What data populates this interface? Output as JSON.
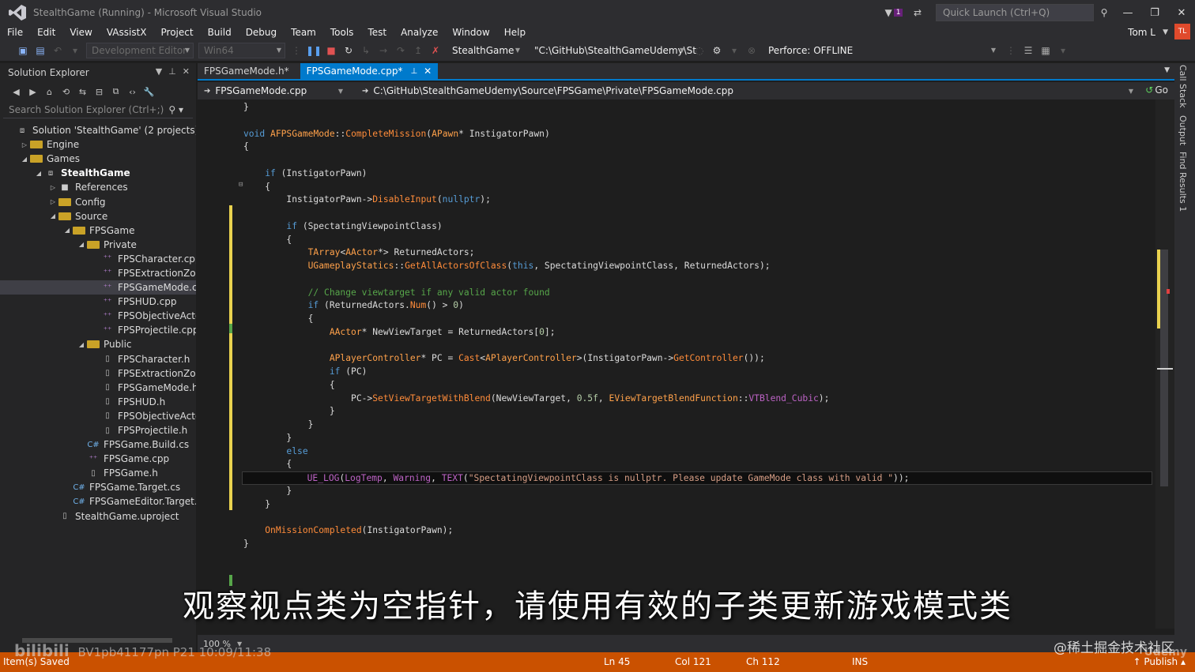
{
  "window": {
    "title": "StealthGame (Running) - Microsoft Visual Studio",
    "notification_count": "1",
    "quick_launch_placeholder": "Quick Launch (Ctrl+Q)"
  },
  "menu": [
    "File",
    "Edit",
    "View",
    "VAssistX",
    "Project",
    "Build",
    "Debug",
    "Team",
    "Tools",
    "Test",
    "Analyze",
    "Window",
    "Help"
  ],
  "user": {
    "name": "Tom L",
    "initials": "TL"
  },
  "toolbar": {
    "configuration": "Development Editor",
    "platform": "Win64",
    "startup_project": "StealthGame",
    "path": "\"C:\\GitHub\\StealthGameUdemy\\St",
    "source_control": "Perforce: OFFLINE"
  },
  "solution_explorer": {
    "title": "Solution Explorer",
    "search_placeholder": "Search Solution Explorer (Ctrl+;)",
    "items": [
      {
        "label": "Solution 'StealthGame' (2 projects)",
        "indent": 0,
        "arrow": "",
        "icon": "solution"
      },
      {
        "label": "Engine",
        "indent": 1,
        "arrow": "▷",
        "icon": "folder"
      },
      {
        "label": "Games",
        "indent": 1,
        "arrow": "◢",
        "icon": "folder"
      },
      {
        "label": "StealthGame",
        "indent": 2,
        "arrow": "◢",
        "icon": "proj",
        "bold": true
      },
      {
        "label": "References",
        "indent": 3,
        "arrow": "▷",
        "icon": "ref"
      },
      {
        "label": "Config",
        "indent": 3,
        "arrow": "▷",
        "icon": "folder"
      },
      {
        "label": "Source",
        "indent": 3,
        "arrow": "◢",
        "icon": "folder"
      },
      {
        "label": "FPSGame",
        "indent": 4,
        "arrow": "◢",
        "icon": "folder"
      },
      {
        "label": "Private",
        "indent": 5,
        "arrow": "◢",
        "icon": "folder"
      },
      {
        "label": "FPSCharacter.cpp",
        "indent": 6,
        "arrow": "",
        "icon": "cpp"
      },
      {
        "label": "FPSExtractionZone.",
        "indent": 6,
        "arrow": "",
        "icon": "cpp"
      },
      {
        "label": "FPSGameMode.cpp",
        "indent": 6,
        "arrow": "",
        "icon": "cpp",
        "selected": true
      },
      {
        "label": "FPSHUD.cpp",
        "indent": 6,
        "arrow": "",
        "icon": "cpp"
      },
      {
        "label": "FPSObjectiveActor.c",
        "indent": 6,
        "arrow": "",
        "icon": "cpp"
      },
      {
        "label": "FPSProjectile.cpp",
        "indent": 6,
        "arrow": "",
        "icon": "cpp"
      },
      {
        "label": "Public",
        "indent": 5,
        "arrow": "◢",
        "icon": "folder"
      },
      {
        "label": "FPSCharacter.h",
        "indent": 6,
        "arrow": "",
        "icon": "hfile"
      },
      {
        "label": "FPSExtractionZone.l",
        "indent": 6,
        "arrow": "",
        "icon": "hfile"
      },
      {
        "label": "FPSGameMode.h",
        "indent": 6,
        "arrow": "",
        "icon": "hfile"
      },
      {
        "label": "FPSHUD.h",
        "indent": 6,
        "arrow": "",
        "icon": "hfile"
      },
      {
        "label": "FPSObjectiveActor.l",
        "indent": 6,
        "arrow": "",
        "icon": "hfile"
      },
      {
        "label": "FPSProjectile.h",
        "indent": 6,
        "arrow": "",
        "icon": "hfile"
      },
      {
        "label": "FPSGame.Build.cs",
        "indent": 5,
        "arrow": "",
        "icon": "cs"
      },
      {
        "label": "FPSGame.cpp",
        "indent": 5,
        "arrow": "",
        "icon": "cpp"
      },
      {
        "label": "FPSGame.h",
        "indent": 5,
        "arrow": "",
        "icon": "hfile"
      },
      {
        "label": "FPSGame.Target.cs",
        "indent": 4,
        "arrow": "",
        "icon": "cs"
      },
      {
        "label": "FPSGameEditor.Target.cs",
        "indent": 4,
        "arrow": "",
        "icon": "cs"
      },
      {
        "label": "StealthGame.uproject",
        "indent": 3,
        "arrow": "",
        "icon": "hfile"
      }
    ]
  },
  "editor": {
    "tabs": [
      {
        "label": "FPSGameMode.h*",
        "active": false
      },
      {
        "label": "FPSGameMode.cpp*",
        "active": true
      }
    ],
    "nav_file": "FPSGameMode.cpp",
    "nav_path": "C:\\GitHub\\StealthGameUdemy\\Source\\FPSGame\\Private\\FPSGameMode.cpp",
    "go_label": "Go",
    "zoom": "100 %",
    "code_lines": [
      "}",
      "",
      "void AFPSGameMode::CompleteMission(APawn* InstigatorPawn)",
      "{",
      "",
      "    if (InstigatorPawn)",
      "    {",
      "        InstigatorPawn->DisableInput(nullptr);",
      "",
      "        if (SpectatingViewpointClass)",
      "        {",
      "            TArray<AActor*> ReturnedActors;",
      "            UGameplayStatics::GetAllActorsOfClass(this, SpectatingViewpointClass, ReturnedActors);",
      "",
      "            // Change viewtarget if any valid actor found",
      "            if (ReturnedActors.Num() > 0)",
      "            {",
      "                AActor* NewViewTarget = ReturnedActors[0];",
      "",
      "                APlayerController* PC = Cast<APlayerController>(InstigatorPawn->GetController());",
      "                if (PC)",
      "                {",
      "                    PC->SetViewTargetWithBlend(NewViewTarget, 0.5f, EViewTargetBlendFunction::VTBlend_Cubic);",
      "                }",
      "            }",
      "        }",
      "        else",
      "        {",
      "            UE_LOG(LogTemp, Warning, TEXT(\"SpectatingViewpointClass is nullptr. Please update GameMode class with valid \"));",
      "        }",
      "    }",
      "",
      "    OnMissionCompleted(InstigatorPawn);",
      "}"
    ],
    "current_line_index": 28
  },
  "side_tabs": [
    "Call Stack",
    "Output",
    "Find Results 1"
  ],
  "subtitle": "观察视点类为空指针，请使用有效的子类更新游戏模式类",
  "status": {
    "message": "Item(s) Saved",
    "line": "Ln 45",
    "col": "Col 121",
    "ch": "Ch 112",
    "mode": "INS",
    "publish": "Publish"
  },
  "watermarks": {
    "bili_logo": "bilibili",
    "video_id": "BV1pb41177pn P21 10:09/11:38",
    "community": "@稀土掘金技术社区",
    "udemy": "Udemy"
  },
  "colors": {
    "accent": "#007acc",
    "statusbar": "#ca5100",
    "editor_bg": "#1e1e1e",
    "chrome_bg": "#2d2d30"
  }
}
